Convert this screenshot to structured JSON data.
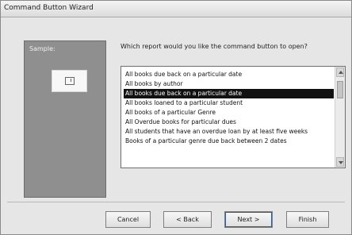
{
  "window": {
    "title": "Command Button Wizard"
  },
  "sample": {
    "label": "Sample:"
  },
  "prompt": "Which report would you like the command button to open?",
  "reports": [
    "All books due back on a particular date",
    "All books by author",
    "All books due back on a particular date",
    "All books loaned to a particular student",
    "All books of a particular Genre",
    "All Overdue books for particular dues",
    "All students that have an overdue loan by at least five weeks",
    "Books of a particular genre due back between 2 dates"
  ],
  "selected_index": 2,
  "buttons": {
    "cancel": "Cancel",
    "back": "< Back",
    "next": "Next >",
    "finish": "Finish"
  }
}
